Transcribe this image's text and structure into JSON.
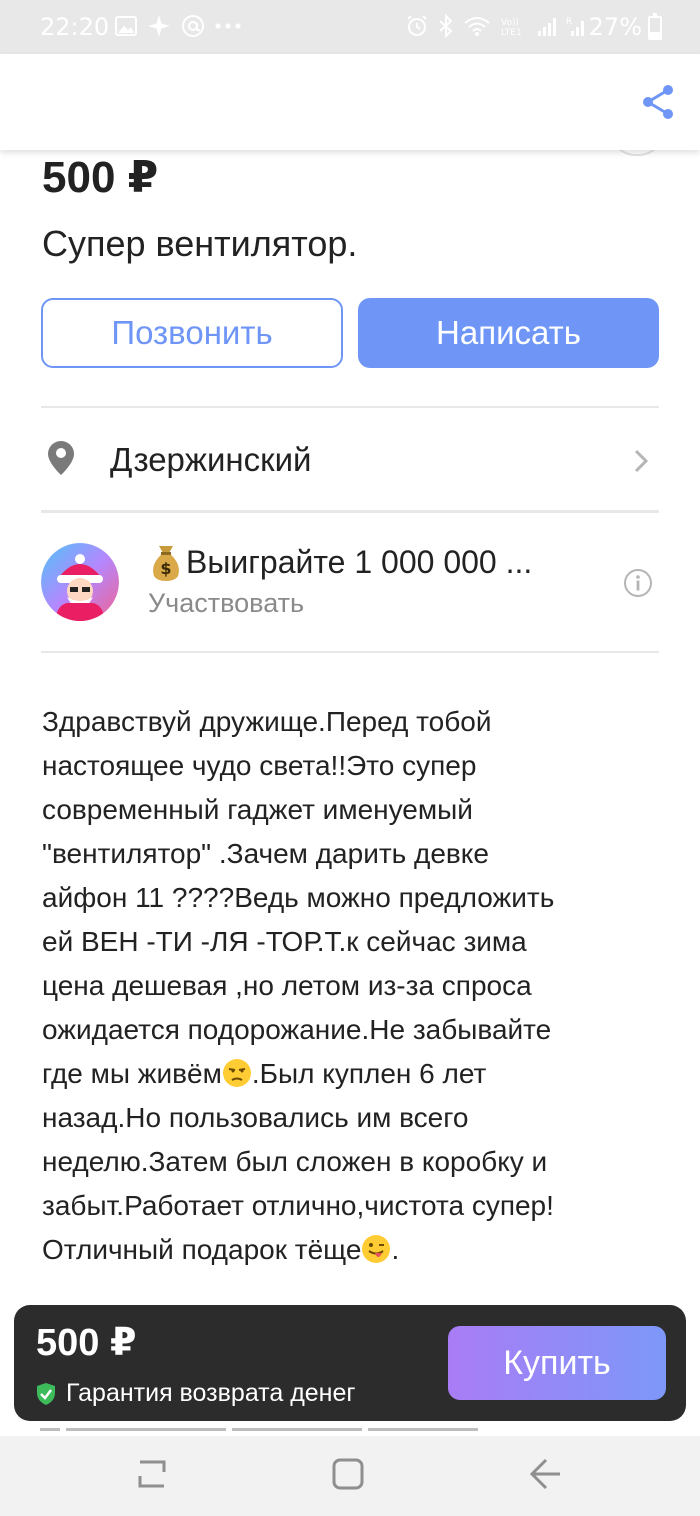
{
  "status_bar": {
    "time": "22:20",
    "battery": "27%",
    "lte_label": "Vo)) LTE1",
    "sim_label": "R"
  },
  "listing": {
    "price": "500 ₽",
    "title": "Супер вентилятор.",
    "call_label": "Позвонить",
    "write_label": "Написать",
    "location": "Дзержинский"
  },
  "ad": {
    "title": "Выиграйте 1 000 000 ...",
    "subtitle": "Участвовать"
  },
  "description": "Здравствуй дружище.Перед тобой\nнастоящее чудо света!!Это супер\nсовременный гаджет именуемый\n\"вентилятор\" .Зачем дарить девке\nайфон 11 ????Ведь можно предложить\nей ВЕН -ТИ -ЛЯ -ТОР.Т.к сейчас зима\nцена дешевая ,но летом из-за спроса\nожидается подорожание.Не забывайте\nгде мы живём",
  "description_2": ".Был куплен 6 лет\nназад.Но пользовались им всего\nнеделю.Затем был сложен в коробку и\nзабыт.Работает отлично,чистота супер!\nОтличный подарок тёще",
  "description_3": ".",
  "buy_bar": {
    "price": "500 ₽",
    "guarantee": "Гарантия возврата денег",
    "buy_label": "Купить"
  },
  "colors": {
    "accent": "#6f96f7",
    "buy_gradient_start": "#a97cf6",
    "buy_gradient_end": "#7d98f8",
    "guarantee_green": "#3dbb5a"
  },
  "icons": [
    "share-icon",
    "location-pin-icon",
    "chevron-right-icon",
    "info-icon",
    "shield-check-icon",
    "money-bag-emoji",
    "unamused-emoji",
    "winking-tongue-emoji"
  ]
}
